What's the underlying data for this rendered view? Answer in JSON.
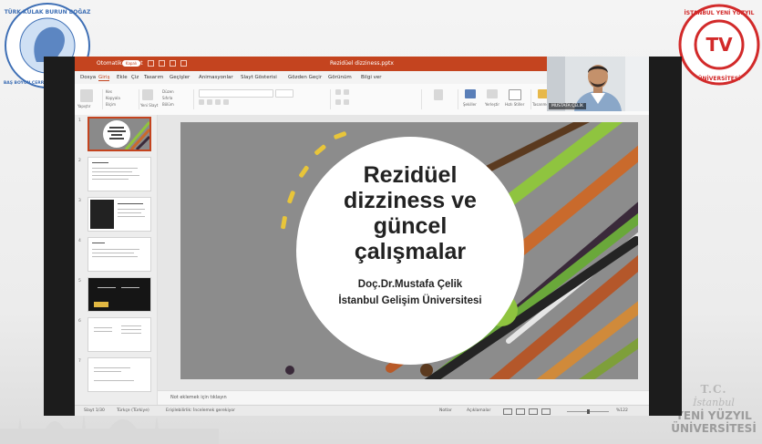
{
  "overlay": {
    "left_logo_text": "TÜRK KULAK BURUN BOĞAZ BAŞ BOYUN CERRAHİSİ DERNEĞİ",
    "left_logo_year": "1953",
    "right_logo_text": "İSTANBUL YENİ YÜZYIL ÜNİVERSİTESİ",
    "right_logo_center": "TV",
    "tc_line1": "T.C.",
    "tc_line2": "İstanbul",
    "tc_line3": "YENİ YÜZYIL",
    "tc_line4": "ÜNİVERSİTESİ"
  },
  "powerpoint": {
    "autosave_label": "Otomatik Kaydet",
    "autosave_state": "Kapalı",
    "file_name": "Rezidüel dizziness.pptx",
    "tabs": [
      "Dosya",
      "Giriş",
      "Ekle",
      "Çiz",
      "Tasarım",
      "Geçişler",
      "Animasyonlar",
      "Slayt Gösterisi",
      "Gözden Geçir",
      "Görünüm",
      "Bilgi ver"
    ],
    "active_tab": "Giriş",
    "ribbon": {
      "paste": "Yapıştır",
      "cut": "Kes",
      "copy": "Kopyala",
      "format_painter": "Biçim",
      "new_slide": "Yeni Slayt",
      "layout": "Düzen",
      "reset": "Sıfırla",
      "section": "Bölüm",
      "shapes": "Şekiller",
      "arrange": "Yerleştir",
      "quick_styles": "Hızlı Stiller",
      "designer": "Tasarımcı"
    },
    "slide_numbers": [
      "1",
      "2",
      "3",
      "4",
      "5",
      "6",
      "7"
    ],
    "notes_placeholder": "Not eklemek için tıklayın",
    "status": {
      "slide_counter": "Slayt 1/30",
      "language": "Türkçe (Türkiye)",
      "accessibility": "Erişilebilirlik: İncelemek gerekiyor",
      "notes_btn": "Notlar",
      "comments_btn": "Açıklamalar",
      "zoom": "%122"
    }
  },
  "slide": {
    "title_lines": [
      "Rezidüel",
      "dizziness ve",
      "güncel",
      "çalışmalar"
    ],
    "author": "Doç.Dr.Mustafa Çelik",
    "institution": "İstanbul Gelişim Üniversitesi"
  },
  "webcam": {
    "name_tag": "MUSTAFA ÇELİK"
  },
  "colors": {
    "ppt_accent": "#c4441f",
    "slide_bg": "#8a8a8a",
    "circle_accent": "#8fc43f"
  }
}
